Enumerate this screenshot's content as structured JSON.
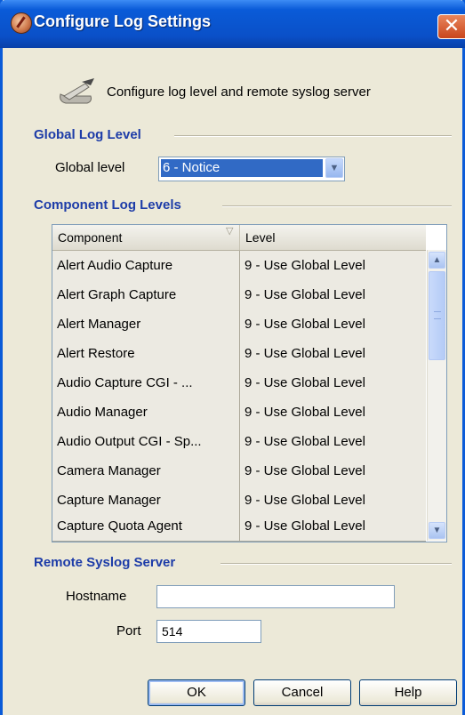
{
  "window": {
    "title": "Configure Log Settings",
    "close_glyph": "✕"
  },
  "header": {
    "icon": "scroll-pen-icon",
    "text": "Configure log level and remote syslog server"
  },
  "global_log": {
    "section_title": "Global Log Level",
    "label": "Global level",
    "selected_value": "6 - Notice"
  },
  "component_log": {
    "section_title": "Component Log Levels",
    "columns": [
      "Component",
      "Level"
    ],
    "rows": [
      {
        "component": "Alert Audio Capture",
        "level": "9 - Use Global Level"
      },
      {
        "component": "Alert Graph Capture",
        "level": "9 - Use Global Level"
      },
      {
        "component": "Alert Manager",
        "level": "9 - Use Global Level"
      },
      {
        "component": "Alert Restore",
        "level": "9 - Use Global Level"
      },
      {
        "component": "Audio Capture CGI - ...",
        "level": "9 - Use Global Level"
      },
      {
        "component": "Audio Manager",
        "level": "9 - Use Global Level"
      },
      {
        "component": "Audio Output CGI - Sp...",
        "level": "9 - Use Global Level"
      },
      {
        "component": "Camera Manager",
        "level": "9 - Use Global Level"
      },
      {
        "component": "Capture Manager",
        "level": "9 - Use Global Level"
      },
      {
        "component": "Capture Quota Agent",
        "level": "9 - Use Global Level"
      }
    ]
  },
  "remote_syslog": {
    "section_title": "Remote Syslog Server",
    "hostname_label": "Hostname",
    "hostname_value": "",
    "port_label": "Port",
    "port_value": "514"
  },
  "buttons": {
    "ok": "OK",
    "cancel": "Cancel",
    "help": "Help"
  },
  "colors": {
    "title_bar": "#0a5bd8",
    "section_title": "#1d3ca8",
    "selection": "#316ac5",
    "dialog_bg": "#ece9d8"
  }
}
